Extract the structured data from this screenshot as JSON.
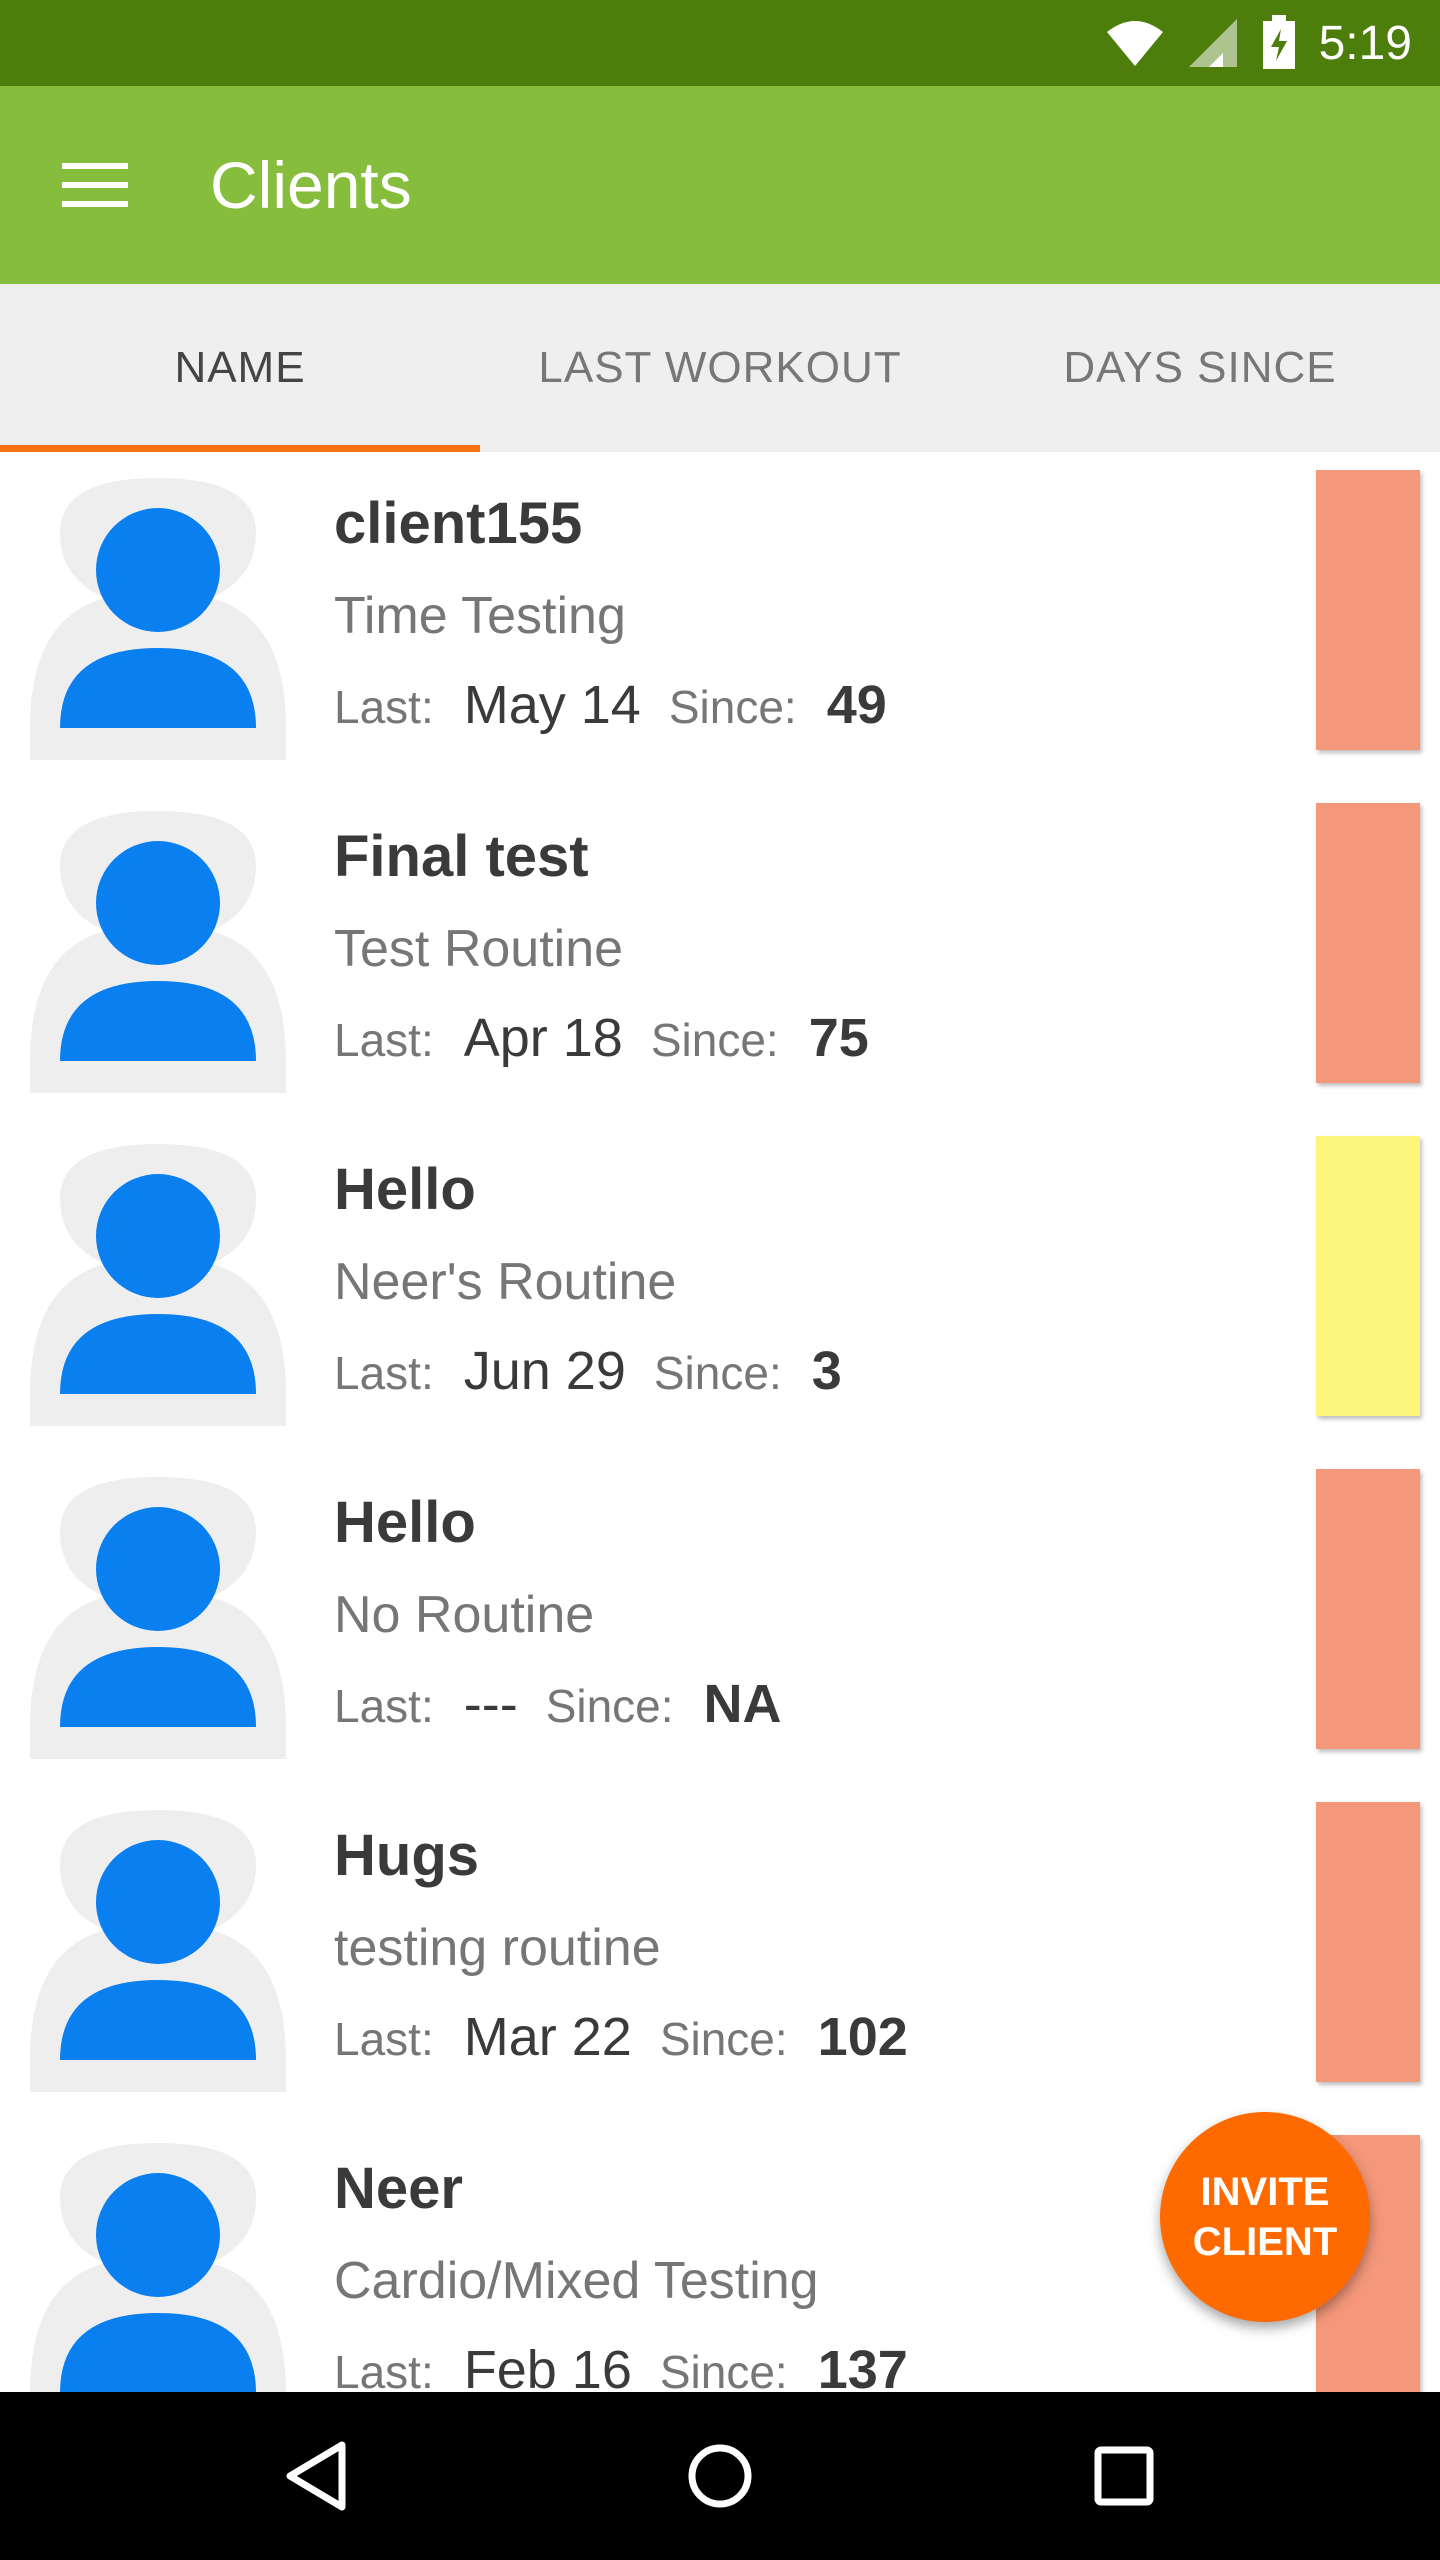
{
  "status_bar": {
    "time": "5:19",
    "icons": [
      "wifi-icon",
      "cell-signal-icon",
      "battery-charging-icon"
    ]
  },
  "app_bar": {
    "title": "Clients",
    "menu_icon": "hamburger-menu-icon",
    "color": "#86bd3c"
  },
  "tabs": [
    {
      "label": "NAME",
      "active": true
    },
    {
      "label": "LAST WORKOUT",
      "active": false
    },
    {
      "label": "DAYS SINCE",
      "active": false
    }
  ],
  "labels": {
    "last": "Last:",
    "since": "Since:"
  },
  "clients": [
    {
      "name": "client155",
      "routine": "Time Testing",
      "last": "May 14",
      "since": "49",
      "status_color": "#f4977a"
    },
    {
      "name": "Final test",
      "routine": "Test Routine",
      "last": "Apr 18",
      "since": "75",
      "status_color": "#f4977a"
    },
    {
      "name": "Hello",
      "routine": "Neer's Routine",
      "last": "Jun 29",
      "since": "3",
      "status_color": "#fbf57b"
    },
    {
      "name": "Hello",
      "routine": "No Routine",
      "last": "---",
      "since": "NA",
      "status_color": "#f4977a"
    },
    {
      "name": "Hugs",
      "routine": "testing routine",
      "last": "Mar 22",
      "since": "102",
      "status_color": "#f4977a"
    },
    {
      "name": "Neer",
      "routine": "Cardio/Mixed Testing",
      "last": "Feb 16",
      "since": "137",
      "status_color": "#f4977a"
    }
  ],
  "fab": {
    "line1": "INVITE",
    "line2": "CLIENT",
    "color": "#ff6a00"
  },
  "nav_bar": {
    "buttons": [
      "back-icon",
      "home-icon",
      "recents-icon"
    ]
  }
}
